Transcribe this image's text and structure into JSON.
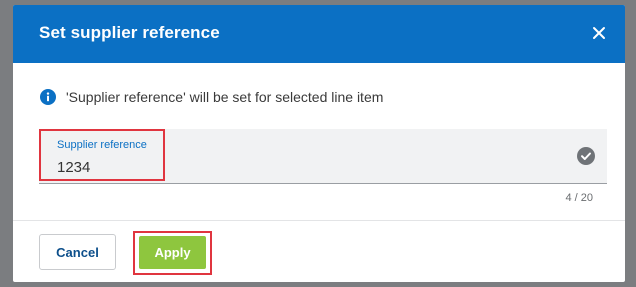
{
  "dialog": {
    "title": "Set supplier reference",
    "close_icon": "close-icon"
  },
  "info": {
    "icon": "info-icon",
    "message": "'Supplier reference' will be set for selected line item"
  },
  "field": {
    "label": "Supplier reference",
    "value": "1234",
    "counter": "4 / 20",
    "status_icon": "check-circle-icon"
  },
  "footer": {
    "cancel_label": "Cancel",
    "apply_label": "Apply"
  },
  "colors": {
    "header": "#0b70c4",
    "apply": "#8ec63e",
    "highlight": "#e0353f"
  }
}
